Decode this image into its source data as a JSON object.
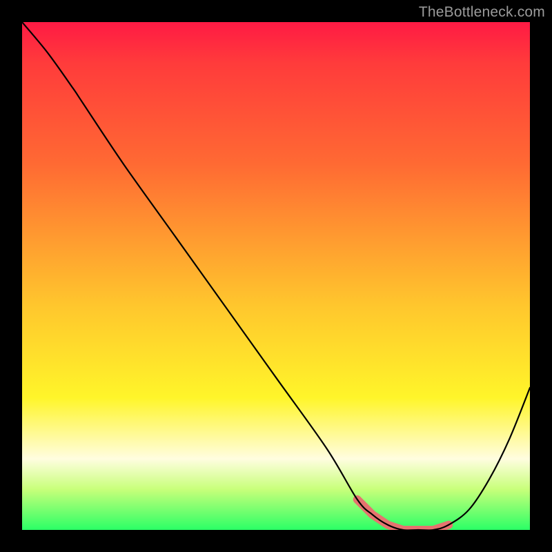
{
  "watermark": {
    "text": "TheBottleneck.com"
  },
  "chart_data": {
    "type": "line",
    "title": "",
    "xlabel": "",
    "ylabel": "",
    "xlim": [
      0,
      100
    ],
    "ylim": [
      0,
      100
    ],
    "grid": false,
    "legend": false,
    "series": [
      {
        "name": "curve",
        "x": [
          0,
          5,
          10,
          12,
          20,
          30,
          40,
          50,
          60,
          66,
          69,
          72,
          75,
          78,
          81,
          84,
          88,
          92,
          96,
          100
        ],
        "y": [
          100,
          94,
          87,
          84,
          72,
          58,
          44,
          30,
          16,
          6,
          3,
          1,
          0,
          0,
          0,
          1,
          4,
          10,
          18,
          28
        ]
      }
    ],
    "highlight": {
      "name": "flat-region",
      "x": [
        66,
        69,
        72,
        75,
        78,
        81,
        84
      ],
      "y": [
        6,
        3,
        1,
        0,
        0,
        0,
        1
      ]
    },
    "background_gradient": {
      "top": "#ff1a44",
      "upper_mid": "#ff9930",
      "mid": "#fff52a",
      "lower_mid": "#fffde0",
      "bottom": "#2bff66"
    }
  }
}
